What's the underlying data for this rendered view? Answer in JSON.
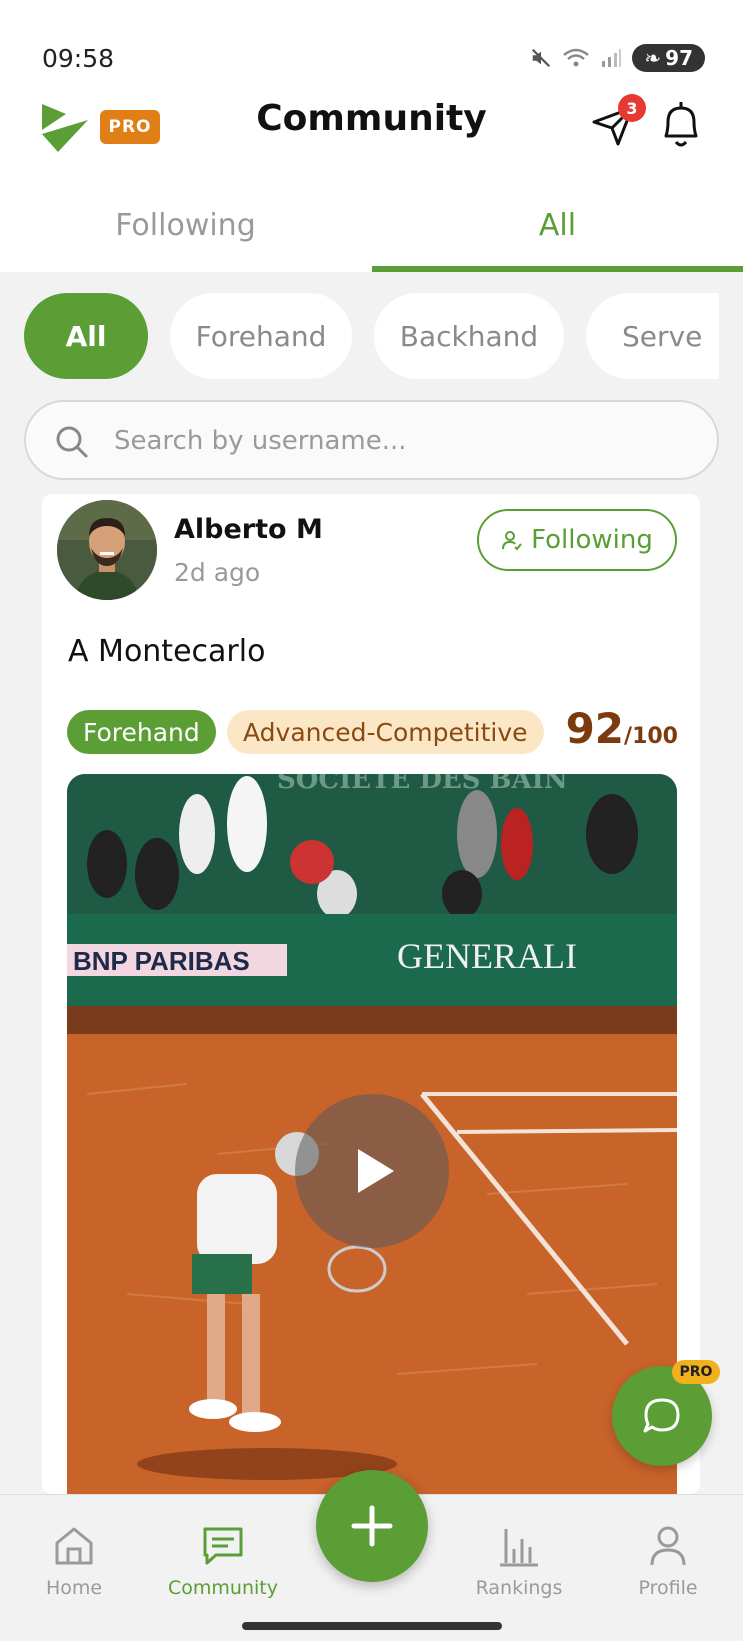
{
  "status_bar": {
    "time": "09:58",
    "battery": "97"
  },
  "header": {
    "title": "Community",
    "pro_badge": "PRO",
    "notification_count": "3"
  },
  "tabs": [
    {
      "label": "Following",
      "active": false
    },
    {
      "label": "All",
      "active": true
    }
  ],
  "filters": [
    {
      "label": "All",
      "active": true
    },
    {
      "label": "Forehand",
      "active": false
    },
    {
      "label": "Backhand",
      "active": false
    },
    {
      "label": "Serve",
      "active": false
    }
  ],
  "search": {
    "placeholder": "Search by username...",
    "value": ""
  },
  "post": {
    "username": "Alberto M",
    "timestamp": "2d ago",
    "follow_label": "Following",
    "text": "A Montecarlo",
    "stroke_tag": "Forehand",
    "level_tag": "Advanced-Competitive",
    "score": "92",
    "score_max": "/100",
    "video": {
      "banner_left": "BNP PARIBAS",
      "banner_right": "GENERALI",
      "wall_text": "SOCIETE DES BAIN"
    }
  },
  "chat_fab": {
    "pro_label": "PRO"
  },
  "bottom_nav": [
    {
      "label": "Home",
      "icon": "home-icon",
      "active": false
    },
    {
      "label": "Community",
      "icon": "chat-icon",
      "active": true
    },
    {
      "label": "Rankings",
      "icon": "bar-chart-icon",
      "active": false
    },
    {
      "label": "Profile",
      "icon": "person-icon",
      "active": false
    }
  ],
  "colors": {
    "brand_green": "#5a9e35",
    "pro_orange": "#e07f15",
    "score_brown": "#7b3b0e",
    "level_tag_bg": "#fbe7c6",
    "clay": "#c8632a"
  }
}
